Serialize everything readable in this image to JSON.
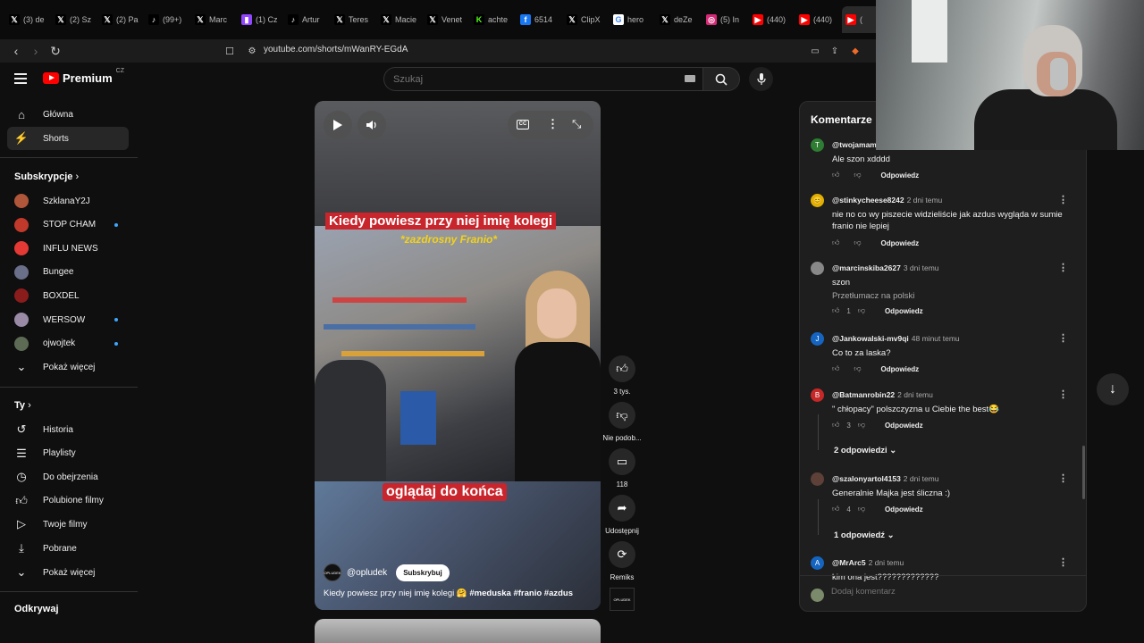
{
  "browser": {
    "tabs": [
      {
        "icon": "x-icon",
        "label": "(3) de"
      },
      {
        "icon": "x-icon",
        "label": "(2) Sz"
      },
      {
        "icon": "x-icon",
        "label": "(2) Pa"
      },
      {
        "icon": "tiktok-icon",
        "label": "(99+)"
      },
      {
        "icon": "x-icon",
        "label": "Marc"
      },
      {
        "icon": "twitch-icon",
        "label": "(1) Cz"
      },
      {
        "icon": "tiktok-icon",
        "label": "Artur"
      },
      {
        "icon": "x-icon",
        "label": "Teres"
      },
      {
        "icon": "x-icon",
        "label": "Macie"
      },
      {
        "icon": "x-icon",
        "label": "Venet"
      },
      {
        "icon": "kick-icon",
        "label": "achte"
      },
      {
        "icon": "facebook-icon",
        "label": "6514"
      },
      {
        "icon": "x-icon",
        "label": "ClipX"
      },
      {
        "icon": "google-icon",
        "label": "hero"
      },
      {
        "icon": "x-icon",
        "label": "deZe"
      },
      {
        "icon": "instagram-icon",
        "label": "(5) In"
      },
      {
        "icon": "youtube-icon",
        "label": "(440)"
      },
      {
        "icon": "youtube-icon",
        "label": "(440)"
      },
      {
        "icon": "youtube-icon",
        "label": "("
      }
    ],
    "url": "youtube.com/shorts/mWanRY-EGdA"
  },
  "header": {
    "logo_text": "Premium",
    "country": "CZ",
    "search_placeholder": "Szukaj"
  },
  "sidebar": {
    "main": [
      {
        "icon": "home-icon",
        "label": "Główna"
      },
      {
        "icon": "shorts-icon",
        "label": "Shorts"
      }
    ],
    "subscriptions_title": "Subskrypcje",
    "subscriptions": [
      {
        "label": "SzklanaY2J",
        "color": "#b0563a",
        "new": false
      },
      {
        "label": "STOP CHAM",
        "color": "#c0392b",
        "new": true
      },
      {
        "label": "INFLU NEWS",
        "color": "#e53935",
        "new": false
      },
      {
        "label": "Bungee",
        "color": "#6a6f8a",
        "new": false
      },
      {
        "label": "BOXDEL",
        "color": "#8b1c1c",
        "new": false
      },
      {
        "label": "WERSOW",
        "color": "#9a8aa6",
        "new": true
      },
      {
        "label": "ojwojtek",
        "color": "#5d6b55",
        "new": true
      }
    ],
    "show_more": "Pokaż więcej",
    "you_title": "Ty",
    "you": [
      {
        "icon": "history-icon",
        "label": "Historia"
      },
      {
        "icon": "playlist-icon",
        "label": "Playlisty"
      },
      {
        "icon": "clock-icon",
        "label": "Do obejrzenia"
      },
      {
        "icon": "like-icon",
        "label": "Polubione filmy"
      },
      {
        "icon": "video-icon",
        "label": "Twoje filmy"
      },
      {
        "icon": "download-icon",
        "label": "Pobrane"
      }
    ],
    "show_more_2": "Pokaż więcej",
    "explore_title": "Odkrywaj"
  },
  "video": {
    "caption_top": "Kiedy powiesz przy niej imię kolegi",
    "caption_sub": "*zazdrosny Franio*",
    "caption_bottom": "oglądaj do końca",
    "channel": "@opludek",
    "channel_avatar_text": "OPLUDEK",
    "subscribe": "Subskrybuj",
    "desc": "Kiedy powiesz przy niej imię kolegi 🤗",
    "tags": " #meduska #franio #azdus"
  },
  "actions": {
    "likes": "3 tys.",
    "dislike": "Nie podob...",
    "comments": "118",
    "share": "Udostępnij",
    "remix": "Remiks"
  },
  "comments": {
    "title": "Komentarze",
    "reply_label": "Odpowiedz",
    "items": [
      {
        "avatar": "T",
        "color": "#2e7d32",
        "user": "@twojamamc",
        "time": "",
        "text": "Ale szon xdddd",
        "likes": "",
        "translate": ""
      },
      {
        "avatar": "😊",
        "color": "#e0b000",
        "user": "@stinkycheese8242",
        "time": "2 dni temu",
        "text": "nie no co wy piszecie widzieliście jak azdus wygląda w sumie franio nie lepiej",
        "likes": "",
        "translate": ""
      },
      {
        "avatar": "",
        "color": "#888",
        "user": "@marcinskiba2627",
        "time": "3 dni temu",
        "text": "szon",
        "likes": "1",
        "translate": "Przetłumacz na polski"
      },
      {
        "avatar": "J",
        "color": "#1565c0",
        "user": "@Jankowalski-mv9qi",
        "time": "48 minut temu",
        "text": "Co to za laska?",
        "likes": "",
        "translate": ""
      },
      {
        "avatar": "B",
        "color": "#c62828",
        "user": "@Batmanrobin22",
        "time": "2 dni temu",
        "text": "\" chłopacy\" polszczyzna u Ciebie the best😂",
        "likes": "3",
        "translate": ""
      },
      {
        "avatar": "",
        "color": "#5d4037",
        "user": "@szalonyartol4153",
        "time": "2 dni temu",
        "text": "Generalnie Majka jest śliczna  :)",
        "likes": "4",
        "translate": ""
      },
      {
        "avatar": "A",
        "color": "#1565c0",
        "user": "@MrArc5",
        "time": "2 dni temu",
        "text": "kim ona jest?????????????",
        "likes": "",
        "translate": ""
      }
    ],
    "replies_1": "2 odpowiedzi",
    "replies_2": "1 odpowiedź",
    "add_placeholder": "Dodaj komentarz"
  }
}
